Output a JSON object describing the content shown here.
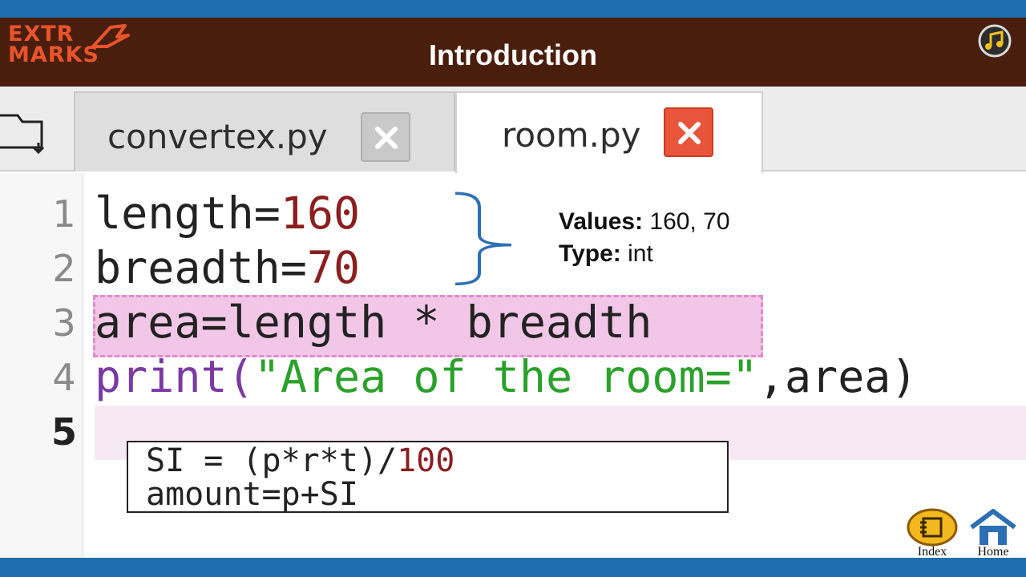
{
  "header": {
    "logo_line1": "EXTR",
    "logo_line2": "MARKS",
    "title": "Introduction"
  },
  "tabs": [
    {
      "label": "convertex.py",
      "active": false
    },
    {
      "label": "room.py",
      "active": true
    }
  ],
  "editor": {
    "line_numbers": [
      "1",
      "2",
      "3",
      "4",
      "5"
    ],
    "lines": {
      "l1": {
        "name": "length",
        "op": "=",
        "value": "160"
      },
      "l2": {
        "name": "breadth",
        "op": "=",
        "value": "70"
      },
      "l3": {
        "text": "area=length * breadth"
      },
      "l4": {
        "func": "print",
        "open": "(",
        "str": "\"Area of the room=\"",
        "rest": ",area)"
      }
    },
    "current_line": 5
  },
  "annotation": {
    "values_label": "Values:",
    "values_text": "160, 70",
    "type_label": "Type:",
    "type_text": "int"
  },
  "formula": {
    "line1_code": "SI = (p*r*t)/",
    "line1_num": "100",
    "line2": "amount=p+SI"
  },
  "nav": {
    "index_label": "Index",
    "home_label": "Home"
  },
  "colors": {
    "frame_blue": "#1f6fae",
    "header_brown": "#4a1e0c",
    "logo_orange": "#e8542b",
    "number_red": "#8a1f1f",
    "keyword_purple": "#7b3aa3",
    "string_green": "#2aa12a",
    "highlight_pink": "#f2c6e6",
    "close_active": "#e8553a"
  },
  "icons": {
    "music": "music-note-icon",
    "folder": "folder-icon",
    "close": "close-x-icon",
    "index": "index-icon",
    "home": "home-icon"
  }
}
